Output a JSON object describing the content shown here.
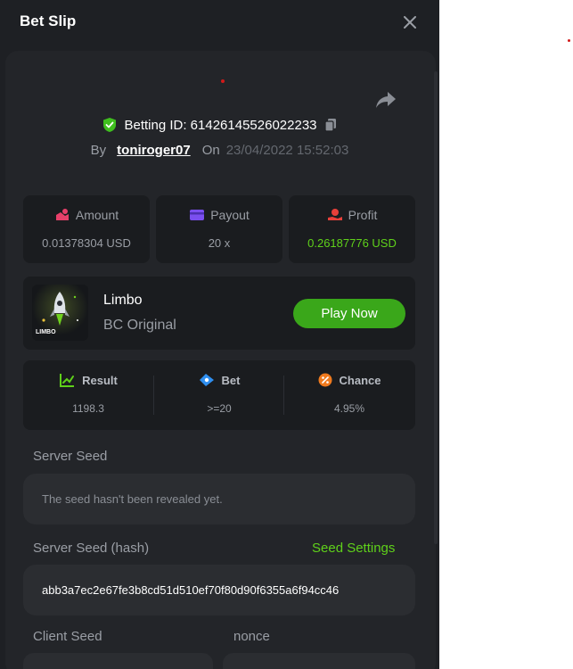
{
  "modal": {
    "title": "Bet Slip"
  },
  "bet": {
    "id_label": "Betting ID: 61426145526022233",
    "by_label": "By",
    "username": "toniroger07",
    "on_label": "On",
    "datetime": "23/04/2022 15:52:03"
  },
  "stats": {
    "amount_label": "Amount",
    "amount_value": "0.01378304 USD",
    "payout_label": "Payout",
    "payout_value": "20 x",
    "profit_label": "Profit",
    "profit_value": "0.26187776 USD"
  },
  "game": {
    "name": "Limbo",
    "subtitle": "BC Original",
    "play_label": "Play Now",
    "thumb_text": "LIMBO"
  },
  "result": {
    "result_label": "Result",
    "result_value": "1198.3",
    "bet_label": "Bet",
    "bet_value": ">=20",
    "chance_label": "Chance",
    "chance_value": "4.95%"
  },
  "seeds": {
    "server_seed_label": "Server Seed",
    "server_seed_value": "The seed hasn't been revealed yet.",
    "server_hash_label": "Server Seed (hash)",
    "seed_settings_label": "Seed Settings",
    "server_hash_value": "abb3a7ec2e67fe3b8cd51d510ef70f80d90f6355a6f94cc46",
    "client_seed_label": "Client Seed",
    "nonce_label": "nonce"
  },
  "colors": {
    "accent_green": "#3aa71a",
    "profit_green": "#5fd11a",
    "modal_bg": "#1e2024",
    "card_bg": "#1a1c1f"
  }
}
